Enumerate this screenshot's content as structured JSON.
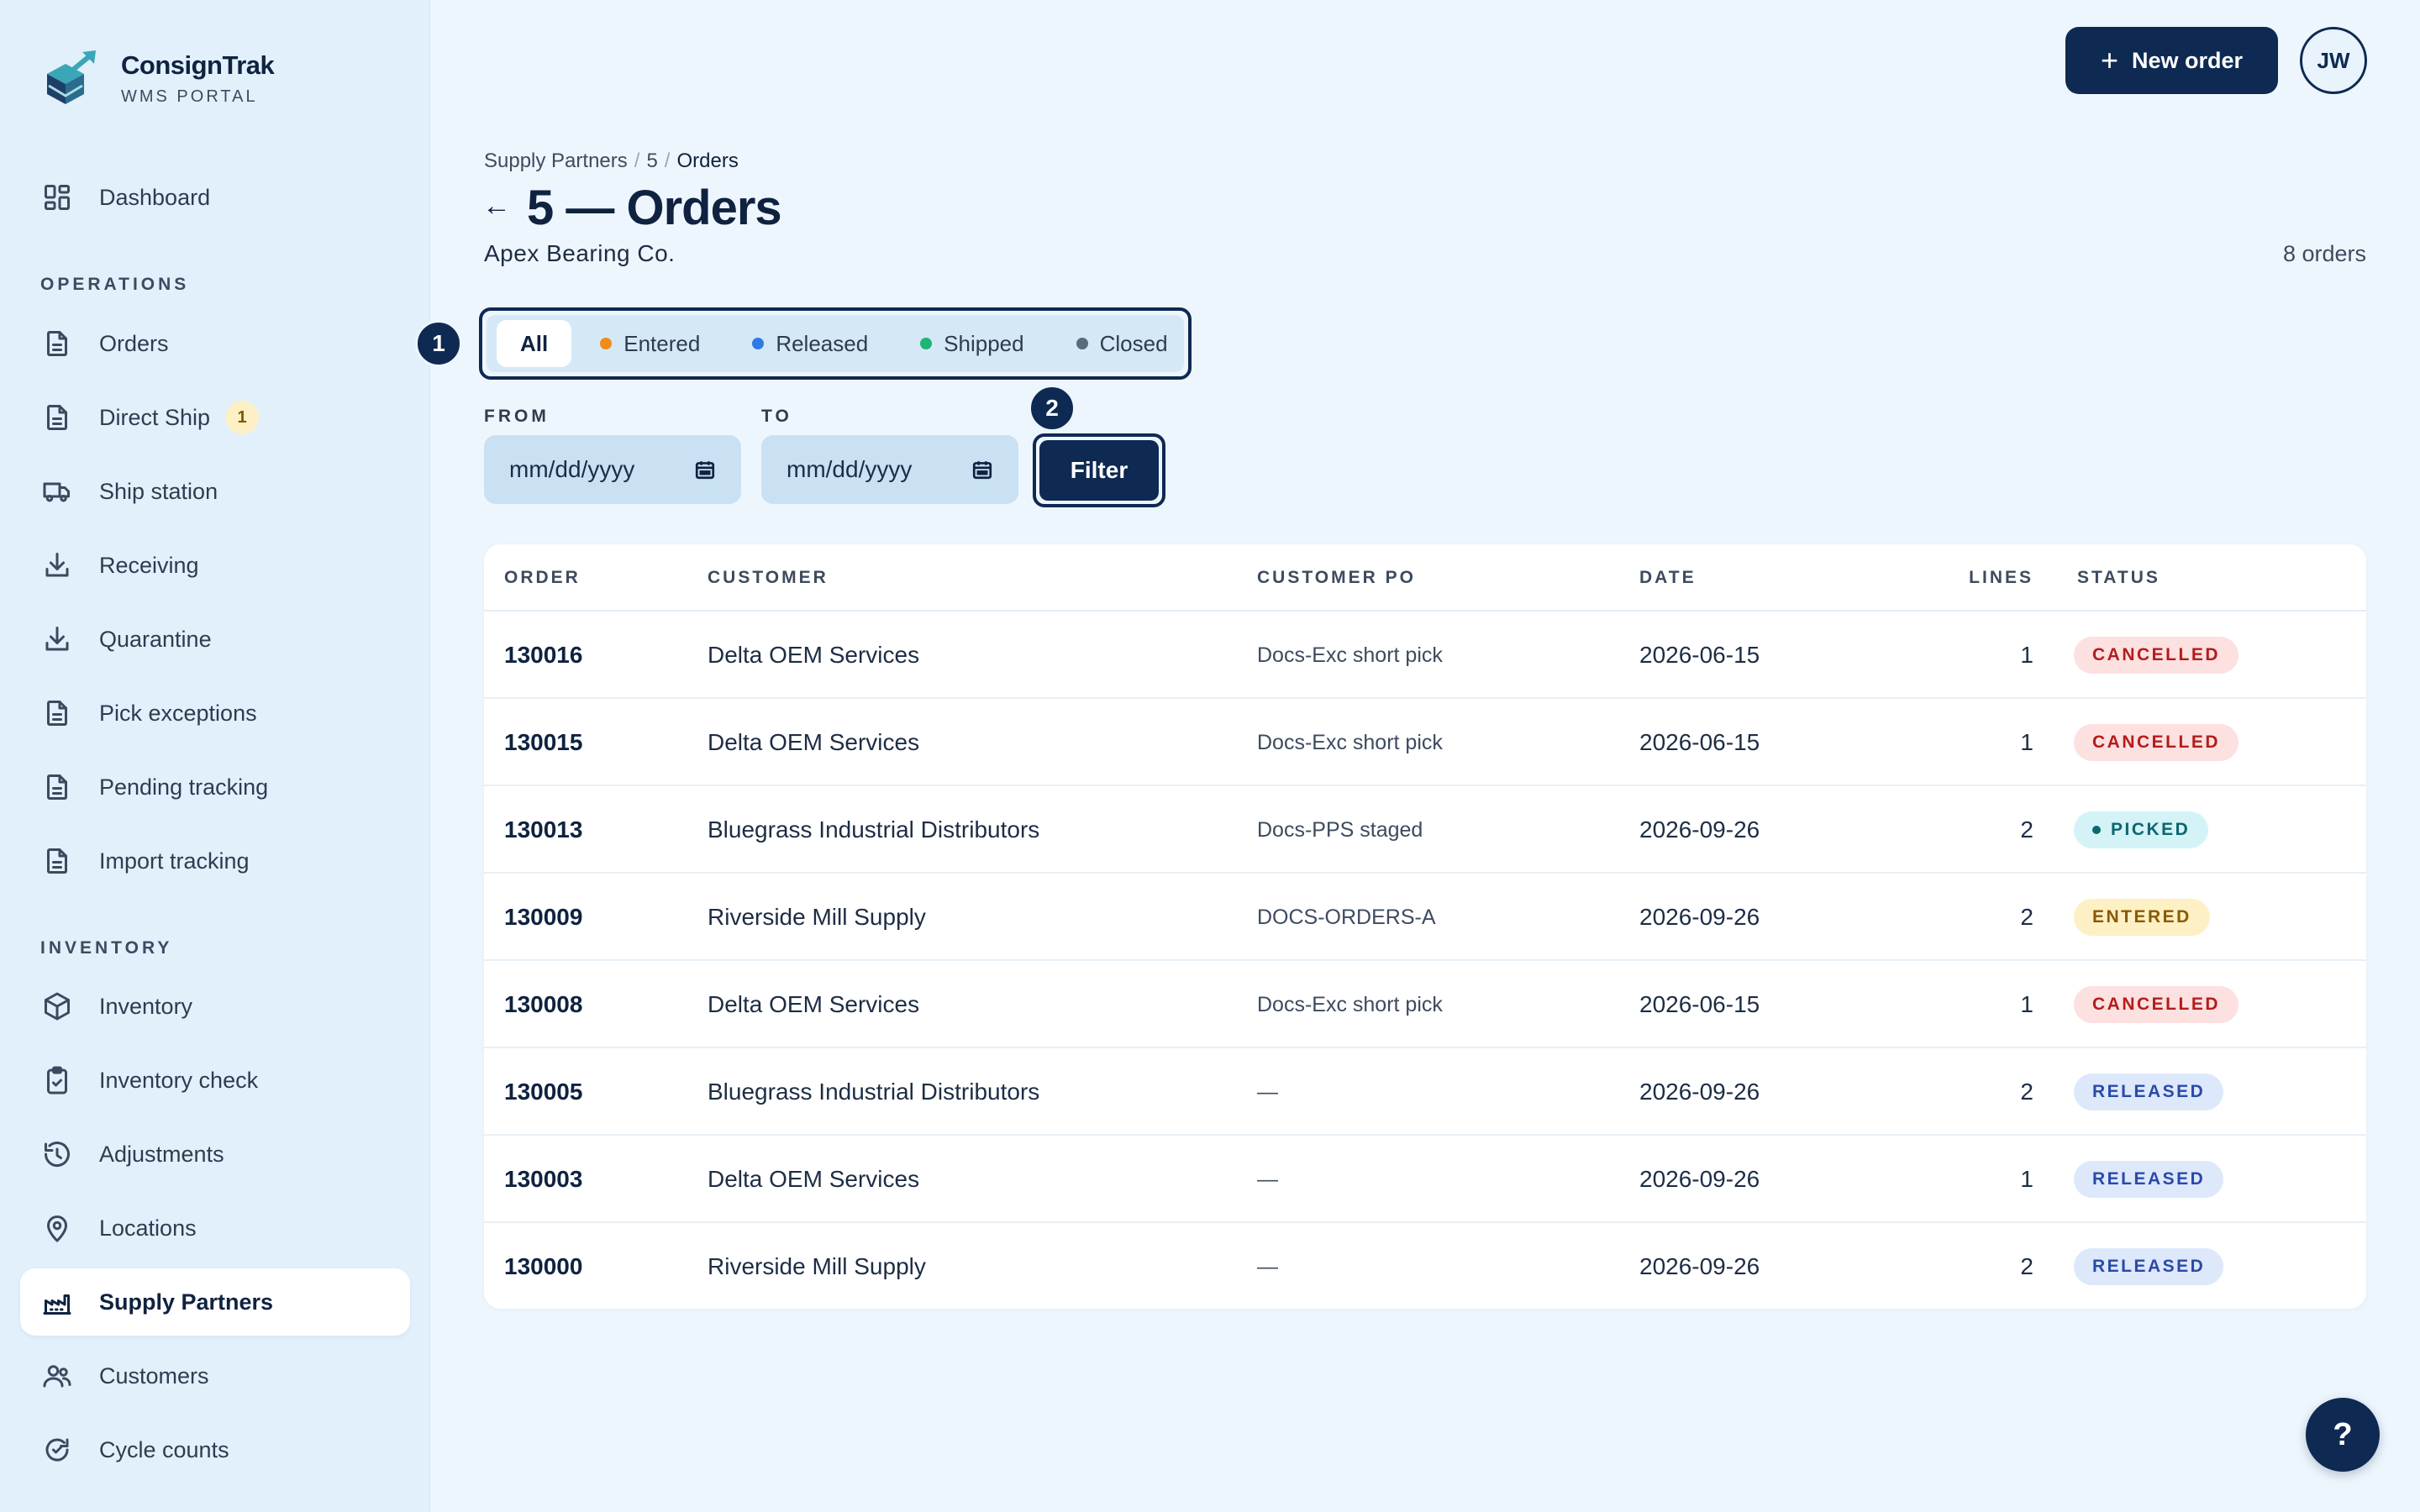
{
  "brand": {
    "name": "ConsignTrak",
    "sub": "WMS PORTAL"
  },
  "sidebar": {
    "dashboard": "Dashboard",
    "section_operations": "OPERATIONS",
    "operations": [
      {
        "label": "Orders",
        "icon": "document-icon"
      },
      {
        "label": "Direct Ship",
        "icon": "document-icon",
        "badge": "1"
      },
      {
        "label": "Ship station",
        "icon": "truck-icon"
      },
      {
        "label": "Receiving",
        "icon": "download-icon"
      },
      {
        "label": "Quarantine",
        "icon": "download-icon"
      },
      {
        "label": "Pick exceptions",
        "icon": "document-icon"
      },
      {
        "label": "Pending tracking",
        "icon": "document-icon"
      },
      {
        "label": "Import tracking",
        "icon": "document-icon"
      }
    ],
    "section_inventory": "INVENTORY",
    "inventory": [
      {
        "label": "Inventory",
        "icon": "box-icon"
      },
      {
        "label": "Inventory check",
        "icon": "clipboard-check-icon"
      },
      {
        "label": "Adjustments",
        "icon": "history-icon"
      },
      {
        "label": "Locations",
        "icon": "map-pin-icon"
      },
      {
        "label": "Supply Partners",
        "icon": "factory-icon",
        "active": true
      },
      {
        "label": "Customers",
        "icon": "users-icon"
      },
      {
        "label": "Cycle counts",
        "icon": "refresh-check-icon"
      }
    ]
  },
  "header": {
    "new_order": "New order",
    "avatar_initials": "JW"
  },
  "breadcrumb": {
    "root": "Supply Partners",
    "sep": "/",
    "id": "5",
    "current": "Orders"
  },
  "page": {
    "back": "←",
    "title": "5 — Orders",
    "subtitle": "Apex Bearing Co.",
    "count": "8 orders"
  },
  "markers": {
    "one": "1",
    "two": "2"
  },
  "tabs": [
    {
      "label": "All",
      "active": true,
      "color": ""
    },
    {
      "label": "Entered",
      "color": "#f08c1a"
    },
    {
      "label": "Released",
      "color": "#2f7ae5"
    },
    {
      "label": "Shipped",
      "color": "#1cb574"
    },
    {
      "label": "Closed",
      "color": "#5b6b7e"
    }
  ],
  "filters": {
    "from_label": "FROM",
    "to_label": "TO",
    "from_value": "mm/dd/yyyy",
    "to_value": "mm/dd/yyyy",
    "button": "Filter"
  },
  "table": {
    "columns": [
      "ORDER",
      "CUSTOMER",
      "CUSTOMER PO",
      "DATE",
      "LINES",
      "STATUS"
    ],
    "rows": [
      {
        "order": "130016",
        "customer": "Delta OEM Services",
        "po": "Docs-Exc short pick",
        "date": "2026-06-15",
        "lines": "1",
        "status": "CANCELLED"
      },
      {
        "order": "130015",
        "customer": "Delta OEM Services",
        "po": "Docs-Exc short pick",
        "date": "2026-06-15",
        "lines": "1",
        "status": "CANCELLED"
      },
      {
        "order": "130013",
        "customer": "Bluegrass Industrial Distributors",
        "po": "Docs-PPS staged",
        "date": "2026-09-26",
        "lines": "2",
        "status": "PICKED"
      },
      {
        "order": "130009",
        "customer": "Riverside Mill Supply",
        "po": "DOCS-ORDERS-A",
        "date": "2026-09-26",
        "lines": "2",
        "status": "ENTERED"
      },
      {
        "order": "130008",
        "customer": "Delta OEM Services",
        "po": "Docs-Exc short pick",
        "date": "2026-06-15",
        "lines": "1",
        "status": "CANCELLED"
      },
      {
        "order": "130005",
        "customer": "Bluegrass Industrial Distributors",
        "po": "—",
        "date": "2026-09-26",
        "lines": "2",
        "status": "RELEASED"
      },
      {
        "order": "130003",
        "customer": "Delta OEM Services",
        "po": "—",
        "date": "2026-09-26",
        "lines": "1",
        "status": "RELEASED"
      },
      {
        "order": "130000",
        "customer": "Riverside Mill Supply",
        "po": "—",
        "date": "2026-09-26",
        "lines": "2",
        "status": "RELEASED"
      }
    ]
  },
  "status_colors": {
    "CANCELLED": {
      "bg": "#fde0e0",
      "fg": "#b41c1c"
    },
    "PICKED": {
      "bg": "#d4f3f7",
      "fg": "#0d6670",
      "dot": "#0d6670"
    },
    "ENTERED": {
      "bg": "#fdf0c4",
      "fg": "#8a5a00"
    },
    "RELEASED": {
      "bg": "#dde8fb",
      "fg": "#2a4aa8"
    }
  },
  "help": "?"
}
